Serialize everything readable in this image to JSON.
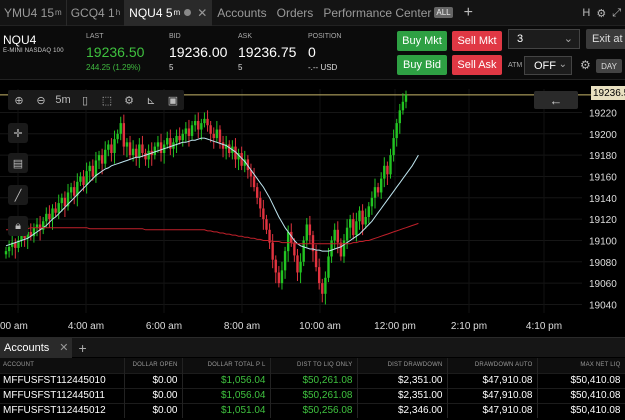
{
  "tabs": [
    {
      "label": "YMU4 15",
      "sup": "m"
    },
    {
      "label": "GCQ4 1",
      "sup": "h"
    },
    {
      "label": "NQU4 5",
      "sup": "m",
      "active": true
    }
  ],
  "nav": {
    "accounts": "Accounts",
    "orders": "Orders",
    "performance": "Performance Center",
    "all_badge": "ALL",
    "right_letter": "H"
  },
  "quote": {
    "symbol": "NQU4",
    "description": "E-MINI NASDAQ 100",
    "last_label": "LAST",
    "last": "19236.50",
    "change": "244.25 (1.29%)",
    "bid_label": "BID",
    "bid": "19236.00",
    "bid_size": "5",
    "ask_label": "ASK",
    "ask": "19236.75",
    "ask_size": "5",
    "position_label": "POSITION",
    "position": "0",
    "position_sub": "-.-- USD"
  },
  "trade": {
    "buy_mkt": "Buy Mkt",
    "sell_mkt": "Sell Mkt",
    "buy_bid": "Buy Bid",
    "sell_ask": "Sell Ask",
    "quantity": "3",
    "exit_label": "Exit at",
    "atm_label": "ATM",
    "atm_value": "OFF",
    "day_label": "DAY"
  },
  "chart_toolbar": {
    "interval": "5m"
  },
  "chart_data": {
    "type": "line",
    "title": "",
    "xlabel": "",
    "ylabel": "",
    "x_ticks": [
      "00 am",
      "4:00 am",
      "6:00 am",
      "8:00 am",
      "10:00 am",
      "12:00 pm",
      "2:10 pm",
      "4:10 pm"
    ],
    "y_ticks": [
      19220,
      19200,
      19180,
      19160,
      19140,
      19120,
      19100,
      19080,
      19060,
      19040
    ],
    "ylim": [
      19032,
      19242
    ],
    "current_price_tag": "19236.50",
    "series": [
      {
        "type": "candles",
        "color_up": "#22c422",
        "color_down": "#e0333f",
        "x": [
          0,
          1,
          2,
          3,
          4,
          5,
          6,
          7,
          8,
          9,
          10,
          11,
          12,
          13,
          14,
          15,
          16,
          17,
          18,
          19,
          20,
          21,
          22,
          23,
          24,
          25,
          26,
          27,
          28,
          29,
          30,
          31,
          32,
          33,
          34,
          35,
          36,
          37,
          38,
          39,
          40,
          41,
          42,
          43,
          44,
          45,
          46,
          47,
          48,
          49,
          50,
          51,
          52,
          53,
          54,
          55,
          56,
          57,
          58,
          59,
          60,
          61,
          62,
          63,
          64,
          65,
          66,
          67,
          68,
          69,
          70,
          71,
          72,
          73,
          74,
          75,
          76,
          77,
          78,
          79,
          80,
          81,
          82,
          83,
          84,
          85,
          86,
          87,
          88,
          89,
          90,
          91,
          92,
          93,
          94,
          95,
          96,
          97,
          98,
          99,
          100,
          101,
          102,
          103,
          104,
          105,
          106,
          107,
          108,
          109,
          110,
          111,
          112,
          113,
          114,
          115,
          116,
          117,
          118,
          119,
          120,
          121,
          122,
          123,
          124,
          125,
          126,
          127,
          128,
          129,
          130,
          131,
          132,
          133
        ],
        "close": [
          19090,
          19094,
          19098,
          19093,
          19100,
          19105,
          19102,
          19108,
          19104,
          19112,
          19115,
          19110,
          19118,
          19125,
          19120,
          19130,
          19126,
          19135,
          19140,
          19132,
          19145,
          19150,
          19142,
          19155,
          19160,
          19152,
          19165,
          19170,
          19160,
          19175,
          19180,
          19172,
          19185,
          19190,
          19182,
          19195,
          19200,
          19210,
          19188,
          19192,
          19180,
          19186,
          19178,
          19190,
          19182,
          19176,
          19184,
          19180,
          19188,
          19192,
          19182,
          19190,
          19196,
          19186,
          19192,
          19198,
          19194,
          19200,
          19205,
          19198,
          19208,
          19212,
          19204,
          19210,
          19214,
          19208,
          19200,
          19196,
          19204,
          19192,
          19186,
          19190,
          19182,
          19188,
          19176,
          19182,
          19170,
          19176,
          19166,
          19160,
          19150,
          19140,
          19130,
          19120,
          19110,
          19098,
          19082,
          19070,
          19060,
          19072,
          19090,
          19108,
          19098,
          19086,
          19070,
          19080,
          19100,
          19115,
          19105,
          19090,
          19075,
          19060,
          19050,
          19065,
          19085,
          19100,
          19110,
          19098,
          19085,
          19100,
          19112,
          19120,
          19105,
          19118,
          19128,
          19115,
          19122,
          19132,
          19140,
          19150,
          19145,
          19158,
          19170,
          19162,
          19180,
          19196,
          19210,
          19222,
          19230,
          19236.5
        ]
      },
      {
        "type": "line",
        "color": "#bfe6f0",
        "label": "",
        "close": [
          19095,
          19096,
          19097,
          19098,
          19099,
          19100,
          19101,
          19102,
          19104,
          19106,
          19108,
          19110,
          19112,
          19114,
          19117,
          19120,
          19122,
          19125,
          19128,
          19131,
          19134,
          19137,
          19140,
          19143,
          19146,
          19149,
          19152,
          19155,
          19158,
          19161,
          19163,
          19165,
          19167,
          19168,
          19170,
          19171,
          19172,
          19173,
          19174,
          19175,
          19176,
          19177,
          19178,
          19178,
          19179,
          19180,
          19181,
          19182,
          19183,
          19184,
          19185,
          19186,
          19187,
          19188,
          19189,
          19190,
          19191,
          19192,
          19192,
          19193,
          19194,
          19194,
          19195,
          19196,
          19196,
          19195,
          19194,
          19193,
          19192,
          19191,
          19190,
          19189,
          19187,
          19185,
          19183,
          19180,
          19177,
          19174,
          19170,
          19166,
          19162,
          19158,
          19154,
          19150,
          19145,
          19140,
          19134,
          19128,
          19122,
          19117,
          19112,
          19108,
          19104,
          19100,
          19097,
          19095,
          19094,
          19093,
          19092,
          19092,
          19091,
          19091,
          19090,
          19090,
          19090,
          19091,
          19092,
          19093,
          19094,
          19096,
          19098,
          19100,
          19102,
          19104,
          19106,
          19109,
          19112,
          19115,
          19118,
          19122,
          19126,
          19130,
          19134,
          19138,
          19142,
          19146,
          19150,
          19154,
          19158,
          19162,
          19166,
          19170,
          19175,
          19180
        ]
      },
      {
        "type": "line",
        "color": "#c0202a",
        "label": "",
        "close": [
          19110,
          19110,
          19110,
          19110,
          19111,
          19111,
          19111,
          19111,
          19112,
          19112,
          19112,
          19112,
          19112,
          19112,
          19112,
          19112,
          19112,
          19112,
          19112,
          19112,
          19112,
          19112,
          19112,
          19112,
          19112,
          19112,
          19112,
          19111,
          19111,
          19111,
          19111,
          19111,
          19111,
          19111,
          19111,
          19111,
          19111,
          19111,
          19111,
          19111,
          19111,
          19111,
          19111,
          19111,
          19111,
          19110,
          19110,
          19110,
          19110,
          19110,
          19110,
          19110,
          19110,
          19110,
          19110,
          19110,
          19110,
          19110,
          19110,
          19110,
          19110,
          19110,
          19110,
          19110,
          19110,
          19109,
          19109,
          19108,
          19108,
          19107,
          19107,
          19106,
          19106,
          19105,
          19105,
          19104,
          19104,
          19103,
          19103,
          19102,
          19102,
          19101,
          19101,
          19100,
          19100,
          19100,
          19099,
          19099,
          19099,
          19098,
          19098,
          19098,
          19098,
          19097,
          19097,
          19097,
          19097,
          19097,
          19097,
          19097,
          19097,
          19097,
          19097,
          19097,
          19097,
          19097,
          19097,
          19097,
          19097,
          19097,
          19097,
          19097,
          19098,
          19098,
          19099,
          19099,
          19100,
          19100,
          19101,
          19102,
          19103,
          19104,
          19105,
          19106,
          19107,
          19108,
          19109,
          19110,
          19111,
          19112,
          19113,
          19114,
          19115,
          19116
        ]
      }
    ]
  },
  "accounts_panel": {
    "tab_label": "Accounts",
    "columns": [
      "ACCOUNT",
      "DOLLAR OPEN",
      "DOLLAR TOTAL P L",
      "DIST TO LIQ ONLY",
      "DIST DRAWDOWN",
      "DRAWDOWN AUTO",
      "MAX NET LIQ"
    ],
    "rows": [
      [
        "MFFUSFST112445010",
        "$0.00",
        "$1,056.04",
        "$50,261.08",
        "$2,351.00",
        "$47,910.08",
        "$50,410.08"
      ],
      [
        "MFFUSFST112445011",
        "$0.00",
        "$1,056.04",
        "$50,261.08",
        "$2,351.00",
        "$47,910.08",
        "$50,410.08"
      ],
      [
        "MFFUSFST112445012",
        "$0.00",
        "$1,051.04",
        "$50,256.08",
        "$2,346.00",
        "$47,910.08",
        "$50,410.08"
      ]
    ]
  },
  "colors": {
    "accent_green": "#2ea043",
    "accent_red": "#e03844",
    "bg": "#000000"
  }
}
